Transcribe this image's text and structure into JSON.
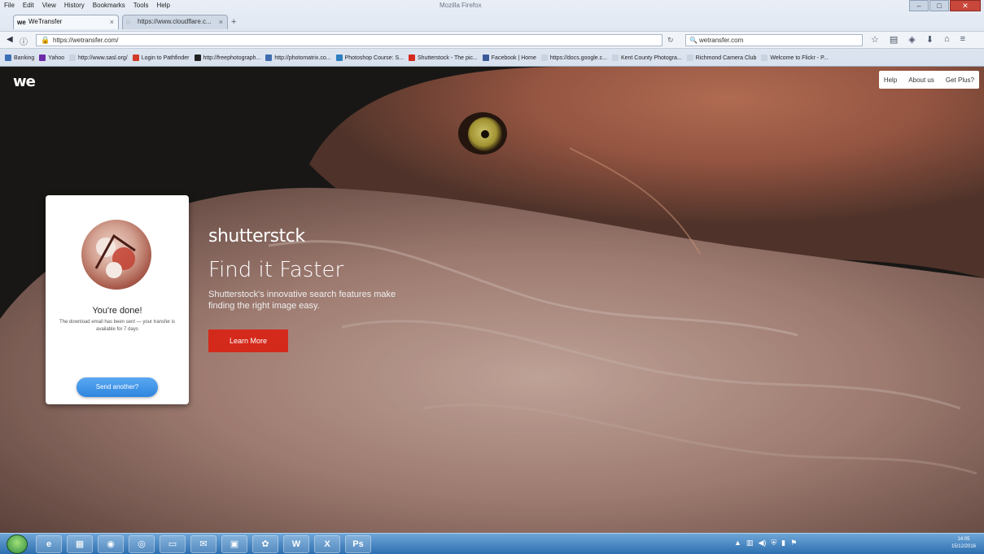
{
  "browser": {
    "menu": [
      "File",
      "Edit",
      "View",
      "History",
      "Bookmarks",
      "Tools",
      "Help"
    ],
    "window_title": "Mozilla Firefox",
    "tabs": [
      {
        "label": "WeTransfer",
        "icon": "we-icon"
      },
      {
        "label": "https://www.cloudflare.c...",
        "icon": "globe-icon"
      }
    ],
    "url": "https://wetransfer.com/",
    "search_value": "wetransfer.com",
    "bookmarks": [
      "Banking",
      "Yahoo",
      "http://www.sasl.org/",
      "Login to Pathfinder",
      "http://freephotograph...",
      "http://photomatrix.co...",
      "Photoshop Course: S...",
      "Shutterstock - The pic...",
      "Facebook | Home",
      "https://docs.google.c...",
      "Kent County Photogra...",
      "Richmond Camera Club",
      "Welcome to Flickr - P..."
    ]
  },
  "page": {
    "logo": "we",
    "nav": {
      "help": "Help",
      "about": "About us",
      "plus": "Get Plus?"
    },
    "card": {
      "title": "You're done!",
      "text": "The download email has been sent — your transfer is available for 7 days",
      "button": "Send another?"
    },
    "ad": {
      "brand": "shutterstck",
      "headline": "Find it Faster",
      "body": "Shutterstock's innovative search features make finding the right image easy.",
      "button": "Learn More",
      "button_color": "#d42a1c"
    }
  },
  "taskbar": {
    "apps": [
      "ie-icon",
      "explorer-icon",
      "firefox-icon",
      "chrome-icon",
      "folder-icon",
      "outlook-icon",
      "photos-icon",
      "paint-icon",
      "W",
      "excel-icon",
      "Ps"
    ],
    "clock_time": "14:05",
    "clock_date": "15/12/2016"
  }
}
